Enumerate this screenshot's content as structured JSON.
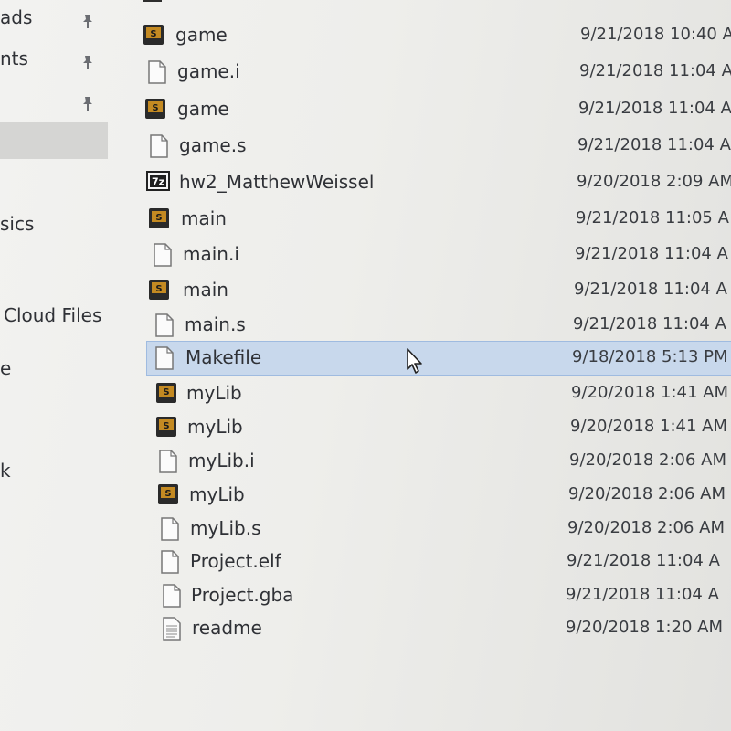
{
  "nav": {
    "items": [
      {
        "label": "ads",
        "pinned": true
      },
      {
        "label": "nts",
        "pinned": true
      },
      {
        "label": "",
        "pinned": true
      },
      {
        "label": "",
        "pinned": false,
        "selected": true
      },
      {
        "label": "sics",
        "pinned": false
      },
      {
        "label": "Cloud Files",
        "pinned": false
      },
      {
        "label": "e",
        "pinned": false
      },
      {
        "label": "k",
        "pinned": false
      }
    ]
  },
  "files": [
    {
      "name": "game",
      "date": "9/21/2018 10:40 A",
      "icon": "asm-source-icon"
    },
    {
      "name": "game.i",
      "date": "9/21/2018 11:04 A",
      "icon": "generic-file-icon"
    },
    {
      "name": "game",
      "date": "9/21/2018 11:04 A",
      "icon": "asm-source-icon"
    },
    {
      "name": "game.s",
      "date": "9/21/2018 11:04 A",
      "icon": "generic-file-icon"
    },
    {
      "name": "hw2_MatthewWeissel",
      "date": "9/20/2018 2:09 AM",
      "icon": "7zip-archive-icon"
    },
    {
      "name": "main",
      "date": "9/21/2018 11:05 A",
      "icon": "asm-source-icon"
    },
    {
      "name": "main.i",
      "date": "9/21/2018 11:04 A",
      "icon": "generic-file-icon"
    },
    {
      "name": "main",
      "date": "9/21/2018 11:04 A",
      "icon": "asm-source-icon"
    },
    {
      "name": "main.s",
      "date": "9/21/2018 11:04 A",
      "icon": "generic-file-icon"
    },
    {
      "name": "Makefile",
      "date": "9/18/2018 5:13 PM",
      "icon": "generic-file-icon",
      "selected": true
    },
    {
      "name": "myLib",
      "date": "9/20/2018 1:41 AM",
      "icon": "asm-source-icon"
    },
    {
      "name": "myLib",
      "date": "9/20/2018 1:41 AM",
      "icon": "asm-source-icon"
    },
    {
      "name": "myLib.i",
      "date": "9/20/2018 2:06 AM",
      "icon": "generic-file-icon"
    },
    {
      "name": "myLib",
      "date": "9/20/2018 2:06 AM",
      "icon": "asm-source-icon"
    },
    {
      "name": "myLib.s",
      "date": "9/20/2018 2:06 AM",
      "icon": "generic-file-icon"
    },
    {
      "name": "Project.elf",
      "date": "9/21/2018 11:04 A",
      "icon": "generic-file-icon"
    },
    {
      "name": "Project.gba",
      "date": "9/21/2018 11:04 A",
      "icon": "generic-file-icon"
    },
    {
      "name": "readme",
      "date": "9/20/2018 1:20 AM",
      "icon": "text-document-icon"
    }
  ],
  "colors": {
    "selection": "#c8d8ec",
    "selection_border": "#9fbbe0",
    "nav_selected": "#d5d5d3",
    "asm_icon_gold": "#c48a22"
  }
}
